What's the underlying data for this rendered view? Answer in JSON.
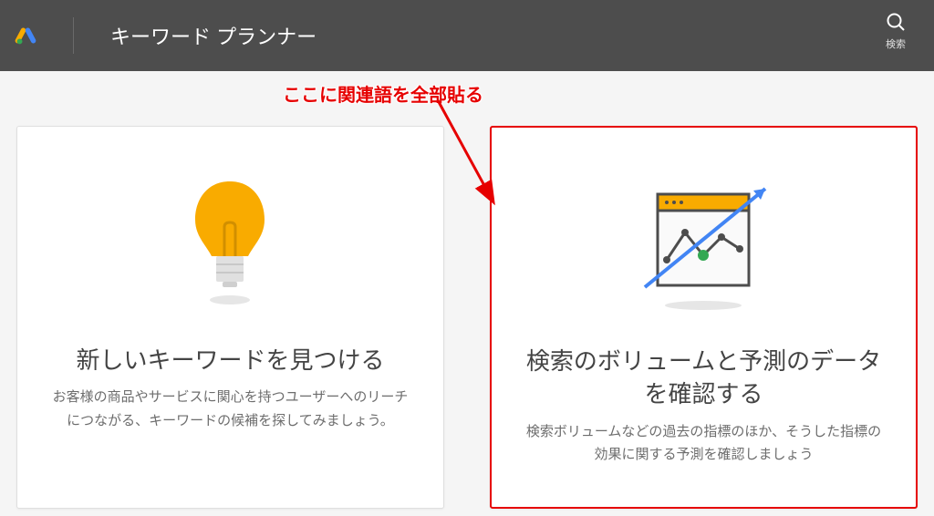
{
  "header": {
    "title": "キーワード プランナー",
    "search_label": "検索"
  },
  "annotation": {
    "text": "ここに関連語を全部貼る"
  },
  "cards": {
    "find_keywords": {
      "title": "新しいキーワードを見つける",
      "desc": "お客様の商品やサービスに関心を持つユーザーへのリーチにつながる、キーワードの候補を探してみましょう。"
    },
    "search_volume": {
      "title": "検索のボリュームと予測のデータを確認する",
      "desc": "検索ボリュームなどの過去の指標のほか、そうした指標の効果に関する予測を確認しましょう"
    }
  }
}
